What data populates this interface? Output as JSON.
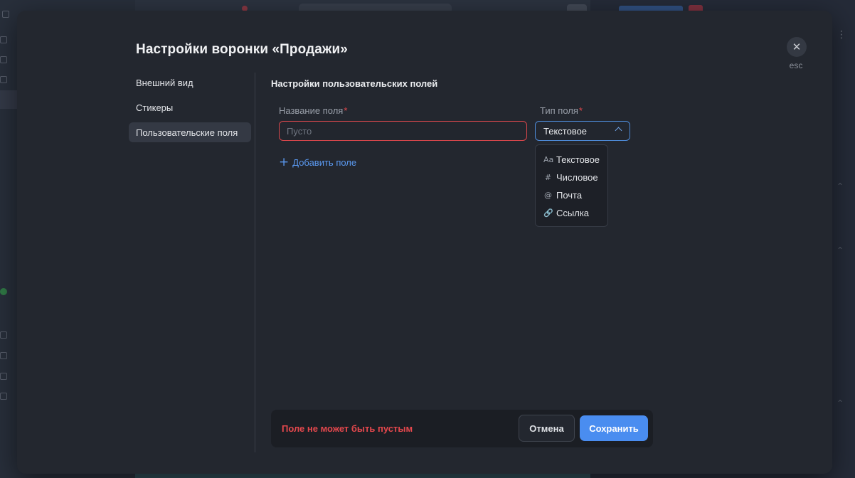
{
  "modal": {
    "title": "Настройки воронки «Продажи»",
    "close_hint": "esc",
    "close_icon": "✕"
  },
  "nav": {
    "items": [
      {
        "label": "Внешний вид",
        "active": false
      },
      {
        "label": "Стикеры",
        "active": false
      },
      {
        "label": "Пользовательские поля",
        "active": true
      }
    ]
  },
  "section": {
    "title": "Настройки пользовательских полей"
  },
  "field": {
    "name_label": "Название поля",
    "name_placeholder": "Пусто",
    "name_value": "",
    "type_label": "Тип поля",
    "required_mark": "*",
    "type_value": "Текстовое",
    "type_options": [
      {
        "label": "Текстовое",
        "icon": "text-format-icon",
        "glyph": "Aa"
      },
      {
        "label": "Числовое",
        "icon": "hash-icon",
        "glyph": "#"
      },
      {
        "label": "Почта",
        "icon": "at-icon",
        "glyph": "@"
      },
      {
        "label": "Ссылка",
        "icon": "link-icon",
        "glyph": "🔗"
      }
    ]
  },
  "add_field": {
    "label": "Добавить поле",
    "icon": "+"
  },
  "footer": {
    "error": "Поле не может быть пустым",
    "cancel": "Отмена",
    "save": "Сохранить"
  },
  "colors": {
    "accent": "#4a8df0",
    "error": "#e5484d",
    "modal_bg": "#23272f"
  }
}
